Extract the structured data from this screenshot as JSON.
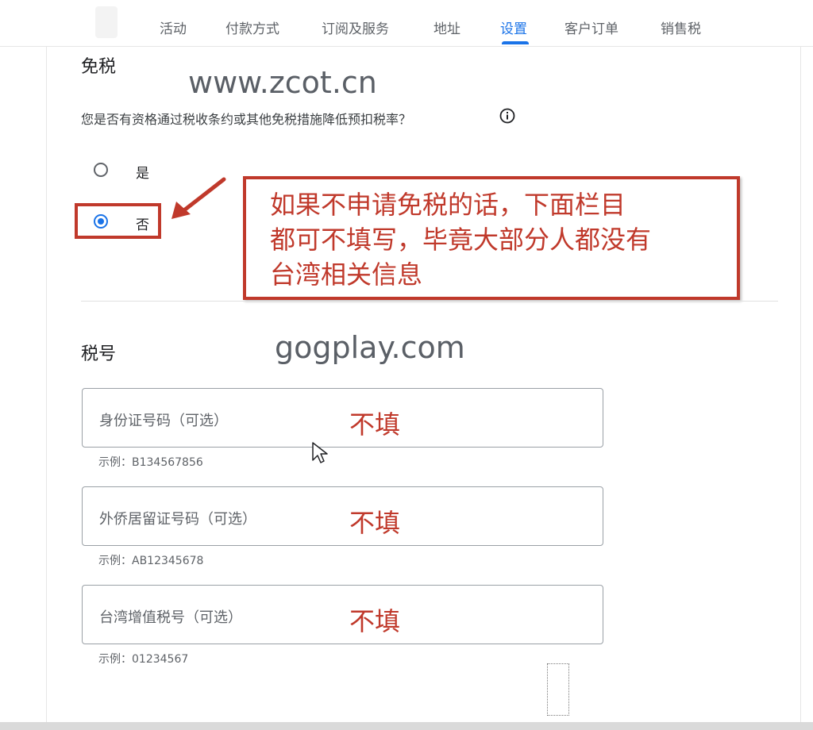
{
  "nav": {
    "tabs": [
      {
        "label": "活动",
        "active": false
      },
      {
        "label": "付款方式",
        "active": false
      },
      {
        "label": "订阅及服务",
        "active": false
      },
      {
        "label": "地址",
        "active": false
      },
      {
        "label": "设置",
        "active": true
      },
      {
        "label": "客户订单",
        "active": false
      },
      {
        "label": "销售税",
        "active": false
      }
    ]
  },
  "exemption": {
    "heading": "免税",
    "question": "您是否有资格通过税收条约或其他免税措施降低预扣税率？",
    "info_icon": "info-circle-icon",
    "options": [
      {
        "label": "是",
        "selected": false
      },
      {
        "label": "否",
        "selected": true
      }
    ]
  },
  "annotation": {
    "callout_lines": [
      "如果不申请免税的话，下面栏目",
      "都可不填写，毕竟大部分人都没有",
      "台湾相关信息"
    ],
    "color": "#c0392b",
    "fill_note": "不填"
  },
  "watermarks": {
    "top": "www.zcot.cn",
    "middle": "gogplay.com"
  },
  "tax_id": {
    "heading": "税号",
    "fields": [
      {
        "placeholder": "身份证号码（可选）",
        "example": "示例：B134567856",
        "value": ""
      },
      {
        "placeholder": "外侨居留证号码（可选）",
        "example": "示例：AB12345678",
        "value": ""
      },
      {
        "placeholder": "台湾增值税号（可选）",
        "example": "示例：01234567",
        "value": ""
      }
    ]
  },
  "colors": {
    "accent": "#1a73e8",
    "annotation_red": "#c0392b"
  }
}
